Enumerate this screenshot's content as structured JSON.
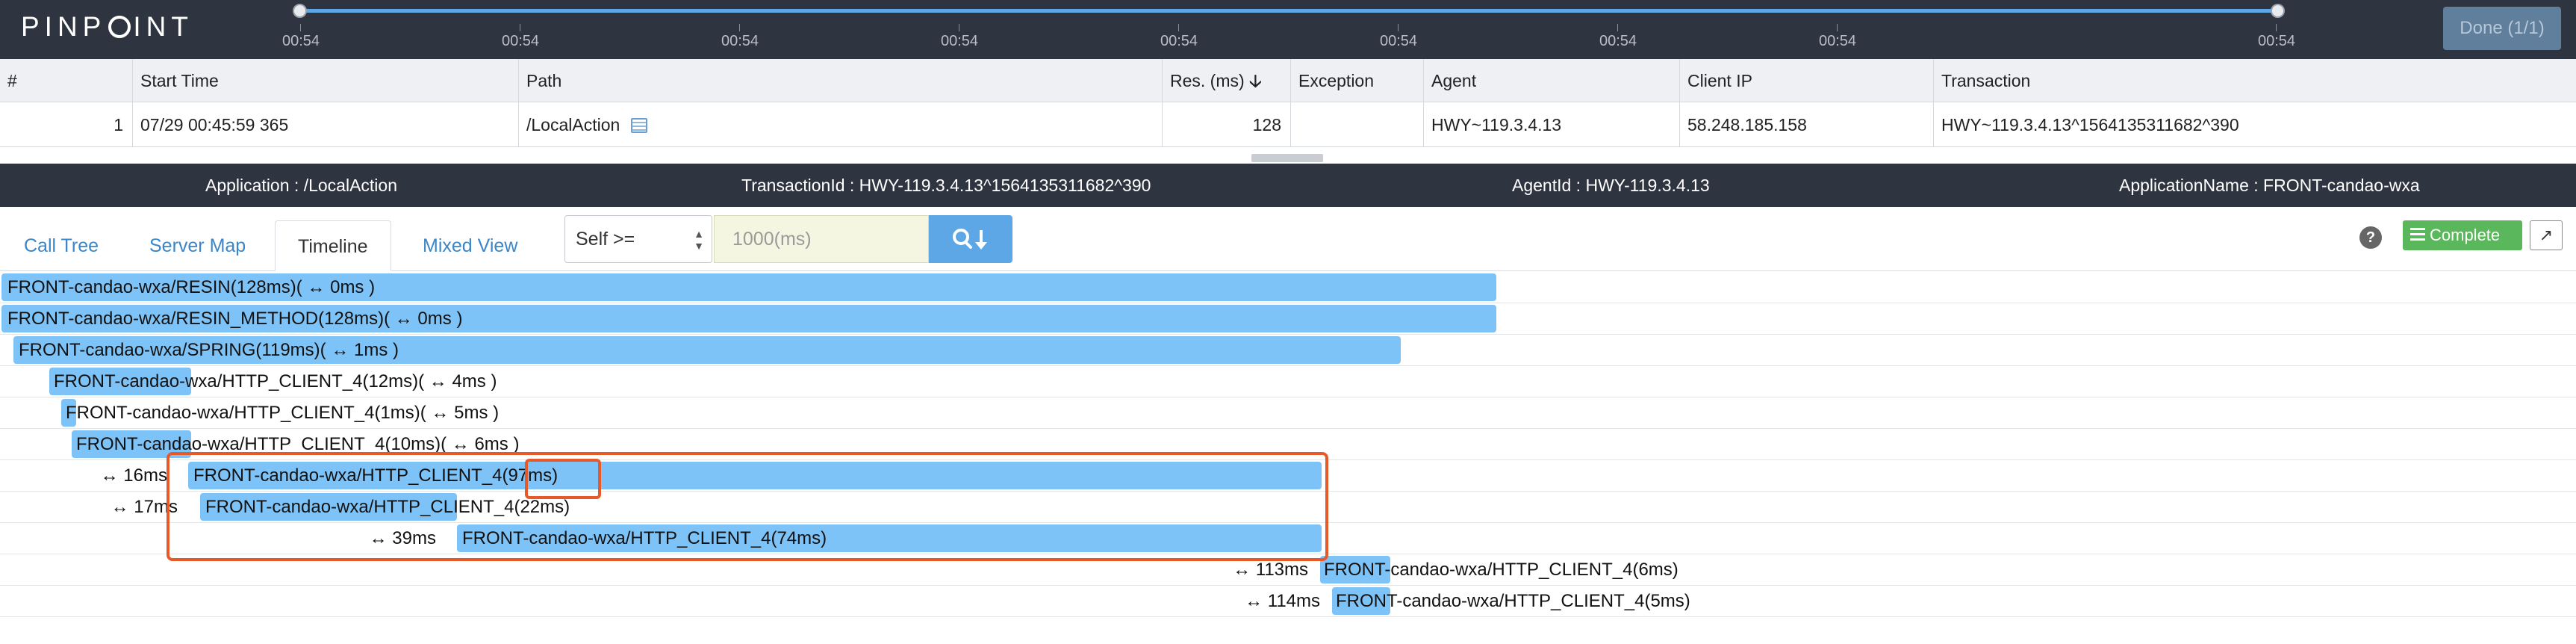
{
  "app": {
    "logo": "PINPOINT"
  },
  "time_slider": {
    "ticks": [
      "00:54",
      "00:54",
      "00:54",
      "00:54",
      "00:54",
      "00:54",
      "00:54",
      "00:54",
      "00:54"
    ],
    "done_label": "Done (1/1)"
  },
  "transaction_list": {
    "columns": [
      "#",
      "Start Time",
      "Path",
      "Res. (ms)",
      "Exception",
      "Agent",
      "Client IP",
      "Transaction"
    ],
    "sort_icon": "arrow-down-icon",
    "rows": [
      {
        "num": "1",
        "start_time": "07/29 00:45:59 365",
        "path": "/LocalAction",
        "res_ms": "128",
        "exception": "",
        "agent": "HWY~119.3.4.13",
        "client_ip": "58.248.185.158",
        "transaction": "HWY~119.3.4.13^1564135311682^390"
      }
    ]
  },
  "info_bar": {
    "application": "Application : /LocalAction",
    "transaction_id": "TransactionId : HWY-119.3.4.13^1564135311682^390",
    "agent_id": "AgentId : HWY-119.3.4.13",
    "application_name": "ApplicationName : FRONT-candao-wxa"
  },
  "tabs": [
    "Call Tree",
    "Server Map",
    "Timeline",
    "Mixed View"
  ],
  "active_tab": "Timeline",
  "filter": {
    "select_value": "Self >=",
    "input_placeholder": "1000(ms)",
    "search_icon": "search-icon"
  },
  "actions": {
    "help_icon": "question-icon",
    "complete_label": "Complete",
    "export_icon": "external-link-icon"
  },
  "timeline": {
    "rows": [
      {
        "label": "FRONT-candao-wxa/RESIN(128ms)( ↔ 0ms )",
        "gap": ""
      },
      {
        "label": "FRONT-candao-wxa/RESIN_METHOD(128ms)( ↔ 0ms )",
        "gap": ""
      },
      {
        "label": "FRONT-candao-wxa/SPRING(119ms)( ↔ 1ms )",
        "gap": ""
      },
      {
        "label": "FRONT-candao-wxa/HTTP_CLIENT_4(12ms)( ↔ 4ms )",
        "gap": ""
      },
      {
        "label": "FRONT-candao-wxa/HTTP_CLIENT_4(1ms)( ↔ 5ms )",
        "gap": ""
      },
      {
        "label": "FRONT-candao-wxa/HTTP_CLIENT_4(10ms)( ↔ 6ms )",
        "gap": ""
      },
      {
        "label": "FRONT-candao-wxa/HTTP_CLIENT_4(97ms)",
        "gap": "↔ 16ms"
      },
      {
        "label": "FRONT-candao-wxa/HTTP_CLIENT_4(22ms)",
        "gap": "↔ 17ms"
      },
      {
        "label": "FRONT-candao-wxa/HTTP_CLIENT_4(74ms)",
        "gap": "↔ 39ms"
      },
      {
        "label": "FRONT-candao-wxa/HTTP_CLIENT_4(6ms)",
        "gap": "↔ 113ms"
      },
      {
        "label": "FRONT-candao-wxa/HTTP_CLIENT_4(5ms)",
        "gap": "↔ 114ms"
      }
    ]
  }
}
